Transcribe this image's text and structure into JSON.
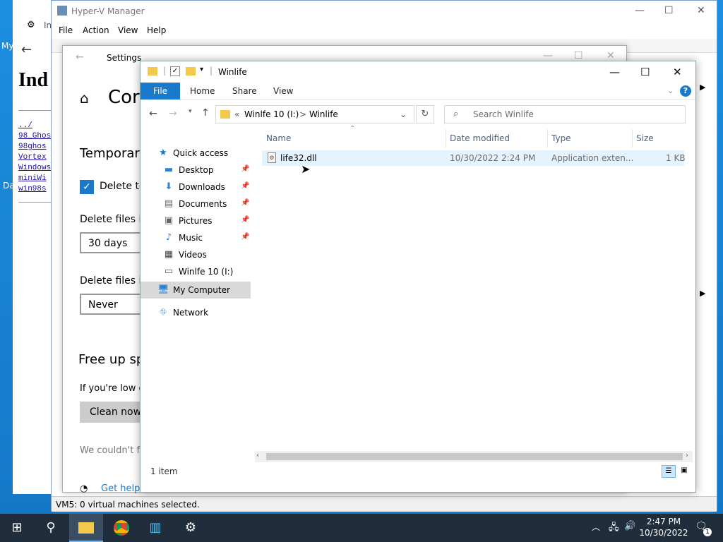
{
  "desktop": {
    "icon1_label": "My",
    "icon2_label": "Da"
  },
  "browser": {
    "heading": "Ind",
    "links": [
      "../",
      "98_Ghos",
      "98ghos",
      "Vortex",
      "Windows",
      "miniWi",
      "win98s"
    ]
  },
  "hyperv": {
    "title": "Hyper-V Manager",
    "menu": [
      "File",
      "Action",
      "View",
      "Help"
    ],
    "tree_item": "In",
    "status": "VM5:  0 virtual machines selected."
  },
  "settings": {
    "title": "Settings",
    "heading": "Cor",
    "temporary": "Temporary",
    "delete_checkbox": "Delete ter",
    "delete_files_1": "Delete files in",
    "value_1": "30 days",
    "delete_files_2": "Delete files in",
    "value_2": "Never",
    "free_up": "Free up sp",
    "low_text": "If you're low c",
    "clean_now": "Clean now",
    "couldnt": "We couldn't fi",
    "get_help": "Get help"
  },
  "explorer": {
    "title": "Winlife",
    "ribbon": {
      "file": "File",
      "home": "Home",
      "share": "Share",
      "view": "View"
    },
    "address": {
      "prefix": "«",
      "drive": "Winlfe 10 (I:)",
      "sep": ">",
      "folder": "Winlife"
    },
    "search_placeholder": "Search Winlife",
    "nav": {
      "quick_access": "Quick access",
      "desktop": "Desktop",
      "downloads": "Downloads",
      "documents": "Documents",
      "pictures": "Pictures",
      "music": "Music",
      "videos": "Videos",
      "drive": "Winlfe 10 (I:)",
      "my_computer": "My Computer",
      "network": "Network"
    },
    "columns": {
      "name": "Name",
      "date": "Date modified",
      "type": "Type",
      "size": "Size"
    },
    "files": [
      {
        "name": "life32.dll",
        "date": "10/30/2022 2:24 PM",
        "type": "Application exten...",
        "size": "1 KB"
      }
    ],
    "status": "1 item"
  },
  "taskbar": {
    "time": "2:47 PM",
    "date": "10/30/2022",
    "notifications": "1"
  },
  "colors": {
    "accent": "#1979ca",
    "selection": "#cce8ff",
    "taskbar": "#1f2d3d"
  }
}
